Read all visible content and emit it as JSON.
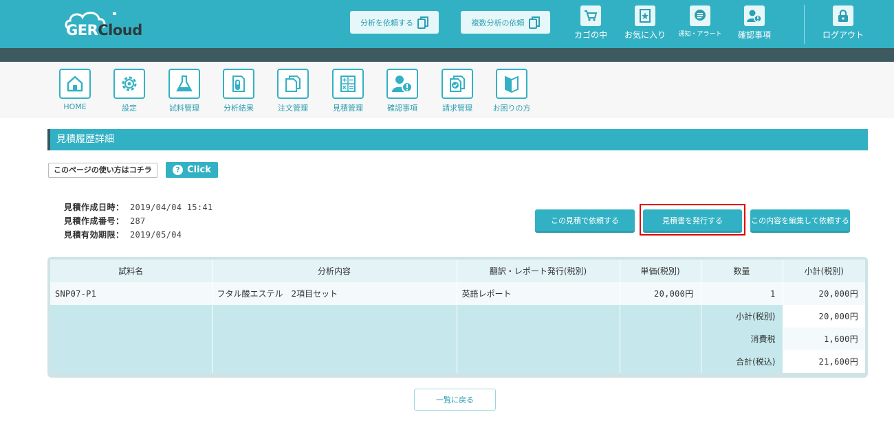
{
  "brand": {
    "logo_text_a": "GER",
    "logo_text_b": "Cloud"
  },
  "header": {
    "request_analysis": "分析を依頼する",
    "request_multi": "複数分析の依頼",
    "nav": [
      {
        "label": "カゴの中",
        "icon": "cart-icon"
      },
      {
        "label": "お気に入り",
        "icon": "star-icon"
      },
      {
        "label": "通知・アラート",
        "icon": "chat-icon"
      },
      {
        "label": "確認事項",
        "icon": "user-alert-icon"
      },
      {
        "label": "ログアウト",
        "icon": "lock-icon"
      }
    ]
  },
  "menu": [
    {
      "label": "HOME",
      "icon": "home-icon"
    },
    {
      "label": "設定",
      "icon": "gear-icon"
    },
    {
      "label": "試料管理",
      "icon": "flask-icon"
    },
    {
      "label": "分析結果",
      "icon": "test-tube-doc-icon"
    },
    {
      "label": "注文管理",
      "icon": "docs-icon"
    },
    {
      "label": "見積管理",
      "icon": "calculator-icon"
    },
    {
      "label": "確認事項",
      "icon": "user-alert-icon"
    },
    {
      "label": "請求管理",
      "icon": "check-doc-icon"
    },
    {
      "label": "お困りの方",
      "icon": "book-icon"
    }
  ],
  "page": {
    "title": "見積履歴詳細",
    "howto": "このページの使い方はコチラ",
    "click": "Click"
  },
  "info": {
    "created_label": "見積作成日時：",
    "created_value": "2019/04/04 15:41",
    "number_label": "見積作成番号：",
    "number_value": "287",
    "expiry_label": "見積有効期限：",
    "expiry_value": "2019/05/04"
  },
  "actions": {
    "request_with": "この見積で依頼する",
    "issue": "見積書を発行する",
    "edit_request": "この内容を編集して依頼する"
  },
  "table": {
    "headers": [
      "試料名",
      "分析内容",
      "翻訳・レポート発行(税別)",
      "単価(税別)",
      "数量",
      "小計(税別)"
    ],
    "rows": [
      {
        "sample": "SNP07-P1",
        "analysis": "フタル酸エステル　2項目セット",
        "translation": "英語レポート",
        "unit_price": "20,000円",
        "qty": "1",
        "subtotal": "20,000円"
      }
    ],
    "summary": [
      {
        "label": "小計(税別)",
        "value": "20,000円"
      },
      {
        "label": "消費税",
        "value": "1,600円"
      },
      {
        "label": "合計(税込)",
        "value": "21,600円"
      }
    ]
  },
  "back": "一覧に戻る",
  "colors": {
    "accent": "#33b1c4",
    "dark": "#3c5a5f",
    "highlight": "#e00000"
  }
}
